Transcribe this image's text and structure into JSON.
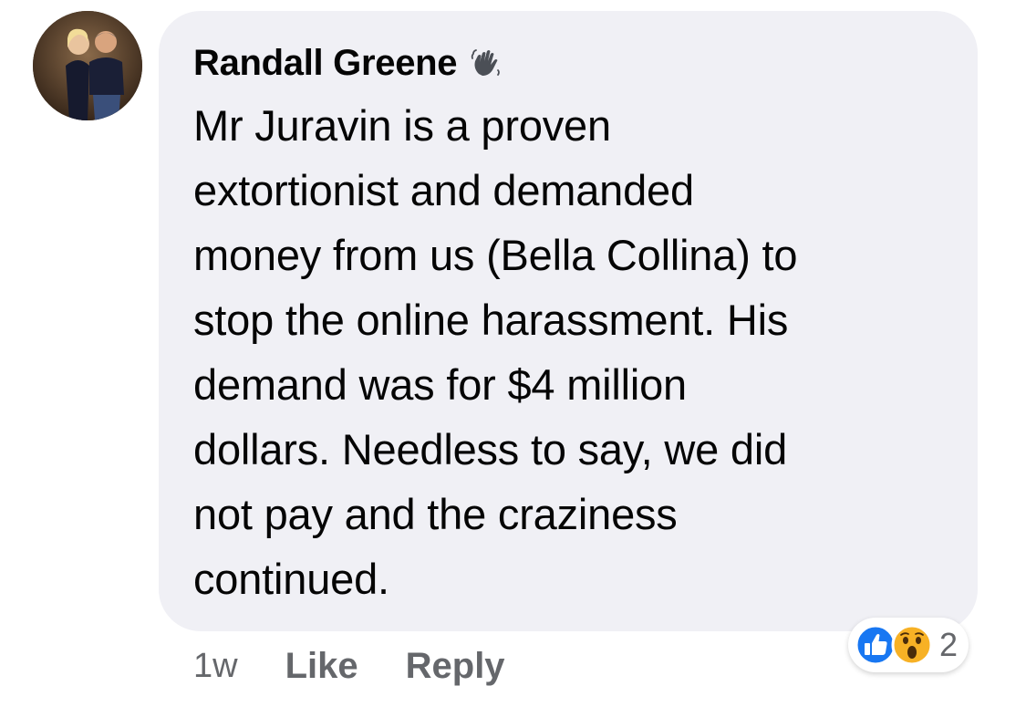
{
  "comment": {
    "author": "Randall Greene",
    "author_badge_icon": "waving-hand-icon",
    "text": "Mr Juravin is a proven\nextortionist and demanded\nmoney from us (Bella Collina) to\nstop the online harassment. His\ndemand was for $4 million\ndollars. Needless to say, we did\nnot pay and the craziness\ncontinued.",
    "timestamp": "1w",
    "like_label": "Like",
    "reply_label": "Reply",
    "reactions": {
      "icons": [
        "like-reaction-icon",
        "wow-reaction-icon"
      ],
      "count": "2"
    }
  },
  "colors": {
    "bubble": "#f0f0f5",
    "text": "#050505",
    "secondary_text": "#65676b",
    "like_blue": "#1877f2",
    "wow_yellow": "#f7b125"
  }
}
